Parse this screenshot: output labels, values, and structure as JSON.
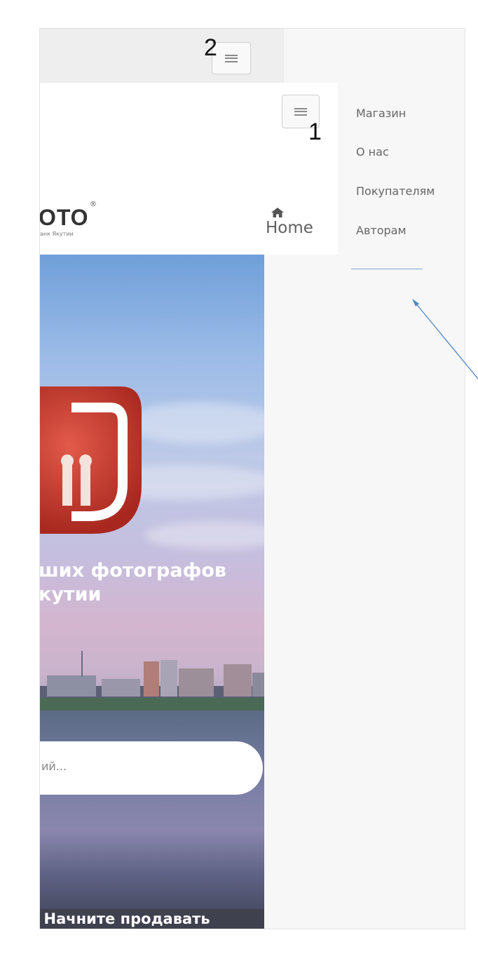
{
  "annotations": {
    "label_top": "2",
    "label_nav": "1"
  },
  "brand": {
    "logo_text": "ОТО",
    "logo_mark": "®",
    "logo_tagline": "анк Якутии"
  },
  "nav": {
    "home_label": "Home",
    "menu": [
      "Магазин",
      "О нас",
      "Покупателям",
      "Авторам"
    ]
  },
  "hero": {
    "headline_line1": "ших фотографов",
    "headline_line2": "кутии",
    "search_placeholder": "ий...",
    "sell_text": "? Начните продавать"
  },
  "colors": {
    "accent_line": "#7fa7d3",
    "logo_red": "#c8352b",
    "arrow": "#4f87c6"
  },
  "icons": {
    "menu_toggle": "hamburger-icon",
    "home": "home-icon"
  }
}
